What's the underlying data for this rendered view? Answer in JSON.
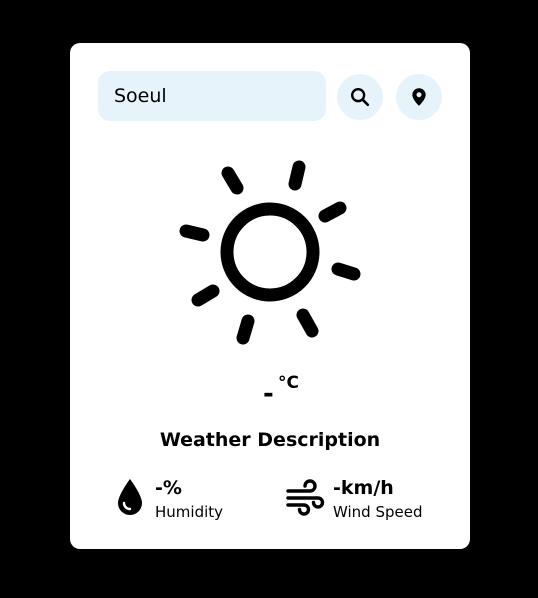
{
  "search": {
    "value": "Soeul",
    "search_icon": "search-icon",
    "location_icon": "location-pin-icon"
  },
  "weather": {
    "icon": "sun-icon",
    "temperature": "-",
    "unit": "°C",
    "description": "Weather Description"
  },
  "humidity": {
    "icon": "water-drop-icon",
    "value": "-%",
    "label": "Humidity"
  },
  "wind": {
    "icon": "wind-icon",
    "value": "-km/h",
    "label": "Wind Speed"
  },
  "colors": {
    "background": "#000000",
    "card": "#ffffff",
    "accent_light": "#e6f3fb",
    "text": "#000000"
  }
}
